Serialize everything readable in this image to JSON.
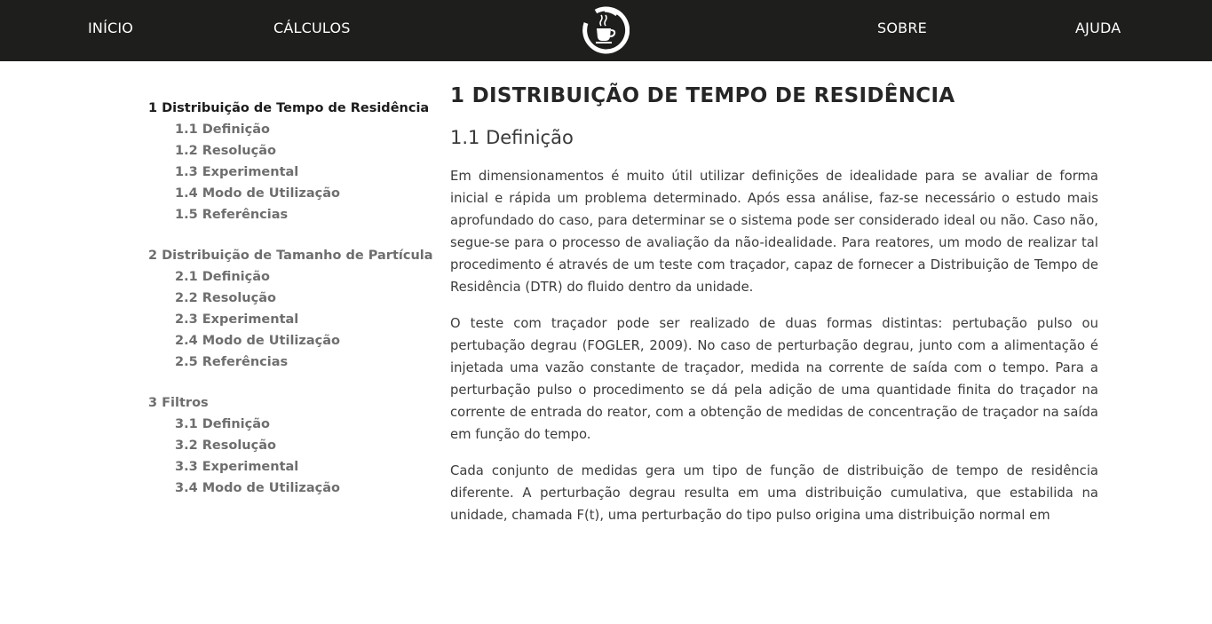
{
  "nav": {
    "inicio": "INÍCIO",
    "calculos": "CÁLCULOS",
    "sobre": "SOBRE",
    "ajuda": "AJUDA"
  },
  "logo": {
    "icon": "coffee-cup-logo-icon"
  },
  "colors": {
    "topbar": "#1e1e1d",
    "toc_active": "#1b1b1b",
    "toc_inactive": "#6e6e6e",
    "text": "#3c3c3c"
  },
  "toc": [
    {
      "title": "1 Distribuição de Tempo de Residência",
      "active": true,
      "items": [
        "1.1 Definição",
        "1.2 Resolução",
        "1.3 Experimental",
        "1.4 Modo de Utilização",
        "1.5 Referências"
      ]
    },
    {
      "title": "2 Distribuição de Tamanho de Partícula",
      "active": false,
      "items": [
        "2.1 Definição",
        "2.2 Resolução",
        "2.3 Experimental",
        "2.4 Modo de Utilização",
        "2.5 Referências"
      ]
    },
    {
      "title": "3 Filtros",
      "active": false,
      "items": [
        "3.1 Definição",
        "3.2 Resolução",
        "3.3 Experimental",
        "3.4 Modo de Utilização"
      ]
    }
  ],
  "content": {
    "heading": "1 DISTRIBUIÇÃO DE TEMPO DE RESIDÊNCIA",
    "subheading": "1.1 Definição",
    "paragraphs": [
      "Em dimensionamentos é muito útil utilizar definições de idealidade para se avaliar de forma inicial e rápida um problema determinado. Após essa análise, faz-se necessário o estudo mais aprofundado do caso, para determinar se o sistema pode ser considerado ideal ou não. Caso não, segue-se para o processo de avaliação da não-idealidade. Para reatores, um modo de realizar tal procedimento é através de um teste com traçador, capaz de fornecer a Distribuição de Tempo de Residência (DTR) do fluido dentro da unidade.",
      "O teste com traçador pode ser realizado de duas formas distintas: pertubação pulso ou pertubação degrau (FOGLER, 2009). No caso de perturbação degrau, junto com a alimentação é injetada uma vazão constante de traçador, medida na corrente de saída com o tempo. Para a perturbação pulso o procedimento se dá pela adição de uma quantidade finita do traçador na corrente de entrada do reator, com a obtenção de medidas de concentração de traçador na saída em função do tempo.",
      "Cada conjunto de medidas gera um tipo de função de distribuição de tempo de residência diferente. A perturbação degrau resulta em uma distribuição cumulativa, que estabilida na unidade, chamada F(t), uma perturbação do tipo pulso origina uma distribuição normal em"
    ]
  }
}
